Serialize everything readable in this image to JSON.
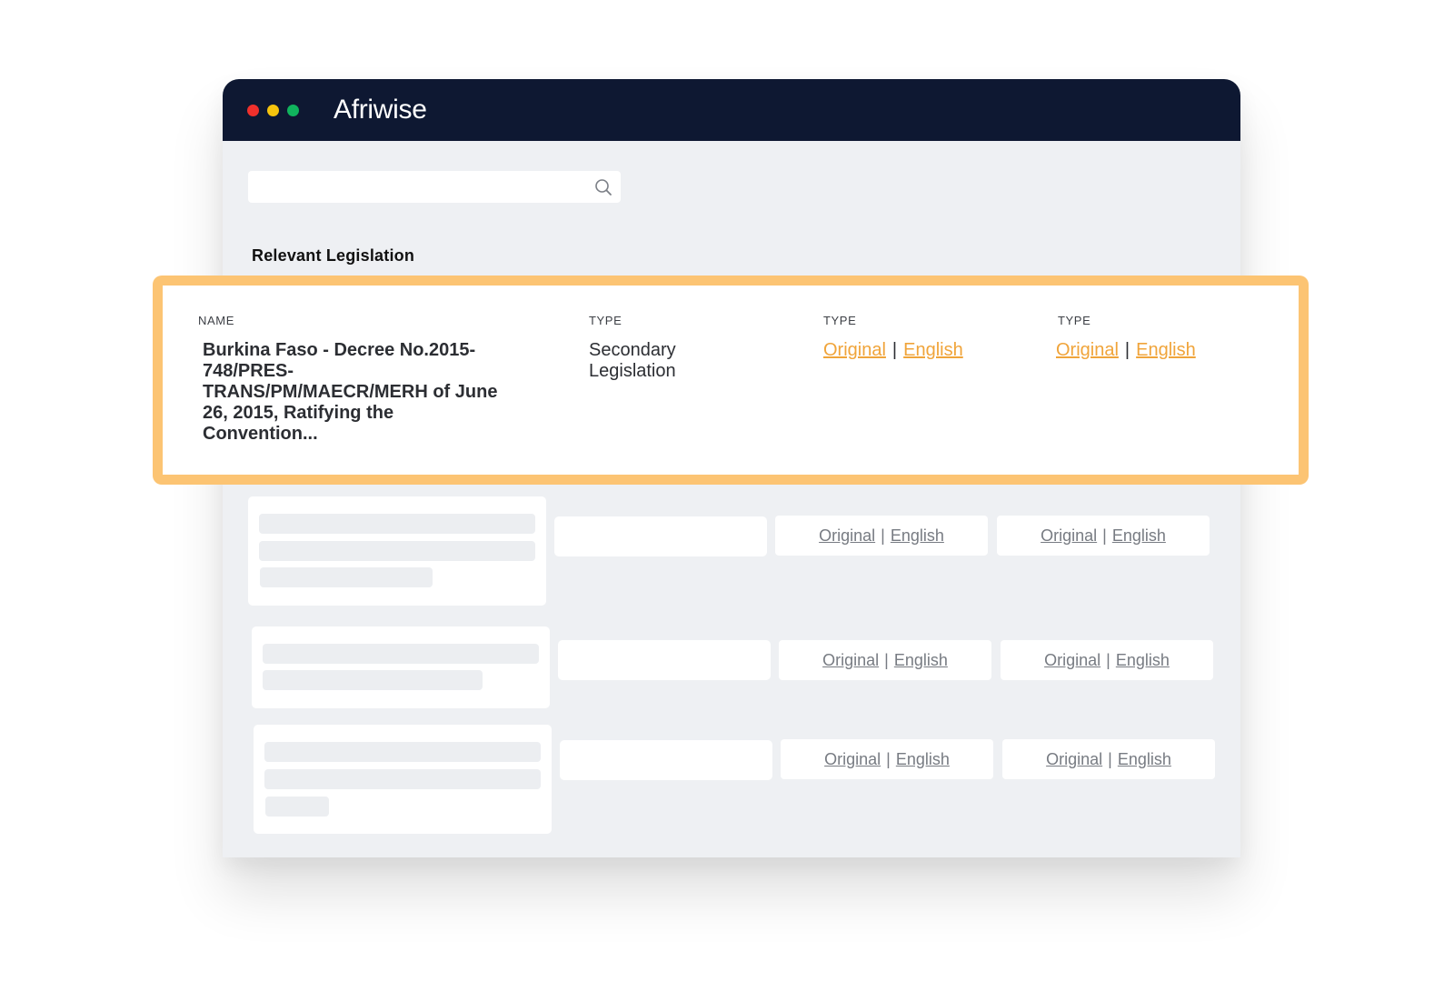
{
  "app": {
    "brand": "Afriwise"
  },
  "search": {
    "value": "",
    "placeholder": ""
  },
  "section": {
    "title": "Relevant Legislation"
  },
  "table": {
    "headers": [
      "NAME",
      "TYPE",
      "TYPE",
      "TYPE"
    ],
    "highlighted_row": {
      "name": "Burkina Faso - Decree No.2015-748/PRES-TRANS/PM/MAECR/MERH of June 26, 2015, Ratifying the Convention...",
      "type": "Secondary Legislation",
      "link_original": "Original",
      "link_english": "English",
      "separator": "|"
    },
    "placeholder_rows": [
      {
        "link_original": "Original",
        "link_english": "English",
        "separator": "|"
      },
      {
        "link_original": "Original",
        "link_english": "English",
        "separator": "|"
      },
      {
        "link_original": "Original",
        "link_english": "English",
        "separator": "|"
      }
    ]
  },
  "colors": {
    "titlebar": "#0e1832",
    "highlight_border": "#fcc473",
    "link_orange": "#f0a43a",
    "page_bg": "#eef0f3"
  }
}
